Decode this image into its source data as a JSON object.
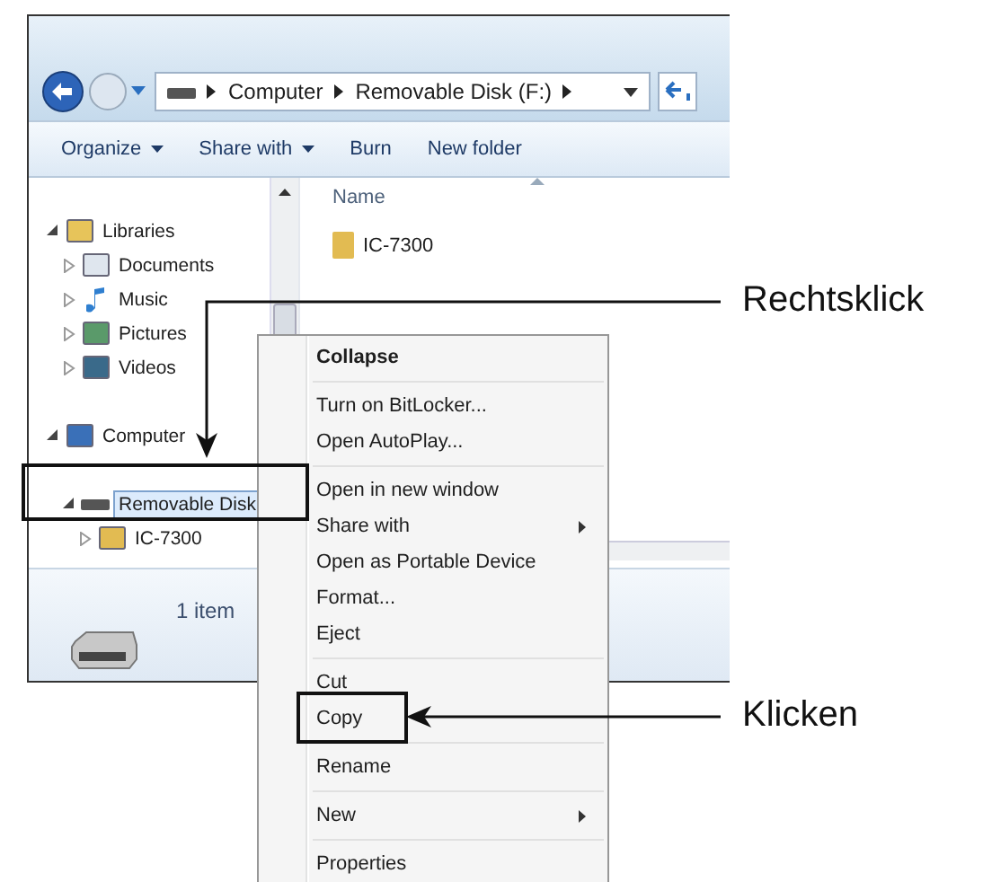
{
  "window": {
    "address": {
      "crumbs": [
        "Computer",
        "Removable Disk (F:)"
      ]
    },
    "toolbar": [
      {
        "label": "Organize",
        "dropdown": true
      },
      {
        "label": "Share with",
        "dropdown": true
      },
      {
        "label": "Burn",
        "dropdown": false
      },
      {
        "label": "New folder",
        "dropdown": false
      }
    ],
    "navigation": [
      {
        "label": "Libraries",
        "kind": "library",
        "expanded": true,
        "selected": false,
        "children": [
          {
            "label": "Documents",
            "kind": "document",
            "expanded": false,
            "selected": false
          },
          {
            "label": "Music",
            "kind": "music",
            "expanded": false,
            "selected": false
          },
          {
            "label": "Pictures",
            "kind": "picture",
            "expanded": false,
            "selected": false
          },
          {
            "label": "Videos",
            "kind": "video",
            "expanded": false,
            "selected": false
          }
        ]
      },
      {
        "label": "Computer",
        "kind": "computer",
        "expanded": true,
        "selected": false,
        "children": [
          {
            "label": "Removable Disk",
            "kind": "drive",
            "expanded": true,
            "selected": true,
            "children": [
              {
                "label": "IC-7300",
                "kind": "folder",
                "expanded": false,
                "selected": false
              }
            ]
          }
        ]
      }
    ],
    "content": {
      "column": "Name",
      "files": [
        {
          "name": "IC-7300"
        }
      ]
    },
    "details": {
      "count": "1 item"
    }
  },
  "context_menu": {
    "items": [
      {
        "kind": "item",
        "label": "Collapse",
        "bold": true,
        "submenu": false
      },
      {
        "kind": "separator"
      },
      {
        "kind": "item",
        "label": "Turn on BitLocker...",
        "bold": false,
        "submenu": false
      },
      {
        "kind": "item",
        "label": "Open AutoPlay...",
        "bold": false,
        "submenu": false
      },
      {
        "kind": "separator"
      },
      {
        "kind": "item",
        "label": "Open in new window",
        "bold": false,
        "submenu": false
      },
      {
        "kind": "item",
        "label": "Share with",
        "bold": false,
        "submenu": true
      },
      {
        "kind": "item",
        "label": "Open as Portable Device",
        "bold": false,
        "submenu": false
      },
      {
        "kind": "item",
        "label": "Format...",
        "bold": false,
        "submenu": false
      },
      {
        "kind": "item",
        "label": "Eject",
        "bold": false,
        "submenu": false
      },
      {
        "kind": "separator"
      },
      {
        "kind": "item",
        "label": "Cut",
        "bold": false,
        "submenu": false
      },
      {
        "kind": "item",
        "label": "Copy",
        "bold": false,
        "submenu": false
      },
      {
        "kind": "separator"
      },
      {
        "kind": "item",
        "label": "Rename",
        "bold": false,
        "submenu": false
      },
      {
        "kind": "separator"
      },
      {
        "kind": "item",
        "label": "New",
        "bold": false,
        "submenu": true
      },
      {
        "kind": "separator"
      },
      {
        "kind": "item",
        "label": "Properties",
        "bold": false,
        "submenu": false
      }
    ]
  },
  "callouts": [
    {
      "text": "Rechtsklick"
    },
    {
      "text": "Klicken"
    }
  ]
}
